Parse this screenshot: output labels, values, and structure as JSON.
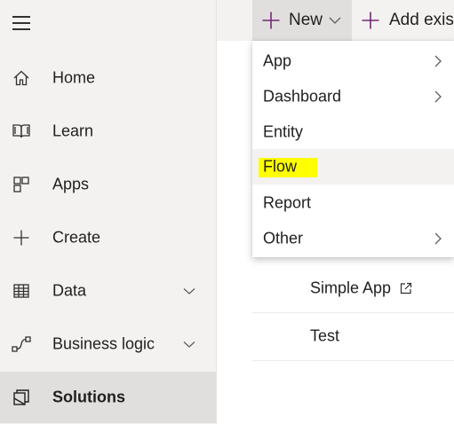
{
  "sidebar": {
    "menu_icon": "hamburger-icon",
    "items": [
      {
        "label": "Home",
        "icon": "home-icon"
      },
      {
        "label": "Learn",
        "icon": "book-icon"
      },
      {
        "label": "Apps",
        "icon": "apps-icon"
      },
      {
        "label": "Create",
        "icon": "plus-icon"
      },
      {
        "label": "Data",
        "icon": "table-icon",
        "expandable": true
      },
      {
        "label": "Business logic",
        "icon": "flow-icon",
        "expandable": true
      },
      {
        "label": "Solutions",
        "icon": "solutions-icon",
        "selected": true
      }
    ]
  },
  "command_bar": {
    "new_label": "New",
    "add_existing_label": "Add existi"
  },
  "new_menu": {
    "items": [
      {
        "label": "App",
        "has_submenu": true
      },
      {
        "label": "Dashboard",
        "has_submenu": true
      },
      {
        "label": "Entity",
        "has_submenu": false
      },
      {
        "label": "Flow",
        "has_submenu": false,
        "hovered": true,
        "highlighted": true
      },
      {
        "label": "Report",
        "has_submenu": false
      },
      {
        "label": "Other",
        "has_submenu": true
      }
    ]
  },
  "solution_list": {
    "rows": [
      {
        "name": "Simple App",
        "icon": "open-external-icon"
      },
      {
        "name": "Test"
      }
    ]
  },
  "colors": {
    "sidebar_bg": "#f3f2f1",
    "selected_bg": "#e1dfdd",
    "brand_purple": "#742774",
    "highlight": "#ffff00",
    "text": "#201f1e"
  }
}
